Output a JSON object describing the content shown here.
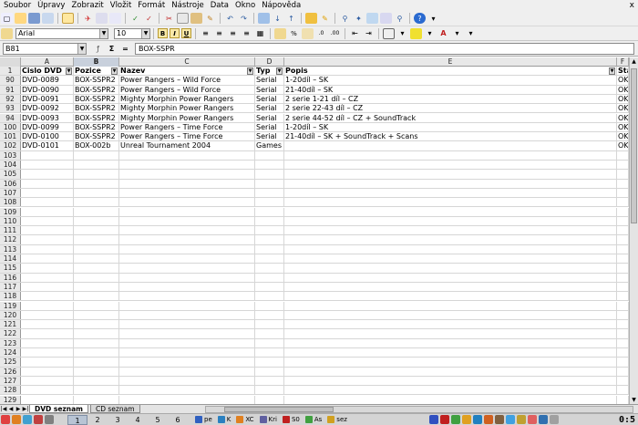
{
  "menu": [
    "Soubor",
    "Úpravy",
    "Zobrazit",
    "Vložit",
    "Formát",
    "Nástroje",
    "Data",
    "Okno",
    "Nápověda"
  ],
  "menu_close": "x",
  "font_name": "Arial",
  "font_size": "10",
  "fmt": {
    "bold": "B",
    "italic": "I",
    "underline": "U"
  },
  "name_box": "B81",
  "formula": "BOX-SSPR",
  "columns": [
    "A",
    "B",
    "C",
    "D",
    "E",
    "F"
  ],
  "selected_column": "B",
  "header_row": {
    "num": "1",
    "cells": [
      "Cislo DVD",
      "Pozice",
      "Nazev",
      "Typ",
      "Popis",
      "Sta"
    ]
  },
  "data_rows": [
    {
      "num": "90",
      "cells": [
        "DVD-0089",
        "BOX-SSPR2",
        "Power Rangers – Wild Force",
        "Serial",
        "1-20díl – SK",
        "OK"
      ]
    },
    {
      "num": "91",
      "cells": [
        "DVD-0090",
        "BOX-SSPR2",
        "Power Rangers – Wild Force",
        "Serial",
        "21-40díl – SK",
        "OK"
      ]
    },
    {
      "num": "92",
      "cells": [
        "DVD-0091",
        "BOX-SSPR2",
        "Mighty Morphin Power Rangers",
        "Serial",
        "2 serie 1-21 díl – CZ",
        "OK"
      ]
    },
    {
      "num": "93",
      "cells": [
        "DVD-0092",
        "BOX-SSPR2",
        "Mighty Morphin Power Rangers",
        "Serial",
        "2 serie 22-43 díl – CZ",
        "OK"
      ]
    },
    {
      "num": "94",
      "cells": [
        "DVD-0093",
        "BOX-SSPR2",
        "Mighty Morphin Power Rangers",
        "Serial",
        "2 serie 44-52 díl – CZ + SoundTrack",
        "OK"
      ]
    },
    {
      "num": "100",
      "cells": [
        "DVD-0099",
        "BOX-SSPR2",
        "Power Rangers – Time Force",
        "Serial",
        "1-20díl – SK",
        "OK"
      ]
    },
    {
      "num": "101",
      "cells": [
        "DVD-0100",
        "BOX-SSPR2",
        "Power Rangers – Time Force",
        "Serial",
        "21-40díl – SK + SoundTrack + Scans",
        "OK"
      ]
    },
    {
      "num": "102",
      "cells": [
        "DVD-0101",
        "BOX-002b",
        "Unreal Tournament 2004",
        "Games",
        "",
        "OK"
      ]
    }
  ],
  "empty_rows": [
    "103",
    "104",
    "105",
    "106",
    "107",
    "108",
    "109",
    "110",
    "111",
    "112",
    "113",
    "114",
    "115",
    "116",
    "117",
    "118",
    "119",
    "120",
    "121",
    "122",
    "123",
    "124",
    "125",
    "126",
    "127",
    "128",
    "129"
  ],
  "sheet_tabs": [
    {
      "label": "DVD seznam",
      "active": true
    },
    {
      "label": "CD seznam",
      "active": false
    }
  ],
  "taskbar": {
    "desktops": [
      "1",
      "2",
      "3",
      "4",
      "5",
      "6"
    ],
    "active_desktop": "1",
    "tasks": [
      "pe",
      "K",
      "XC",
      "Kri",
      "S0",
      "As",
      "sez"
    ],
    "clock": "0:5"
  }
}
